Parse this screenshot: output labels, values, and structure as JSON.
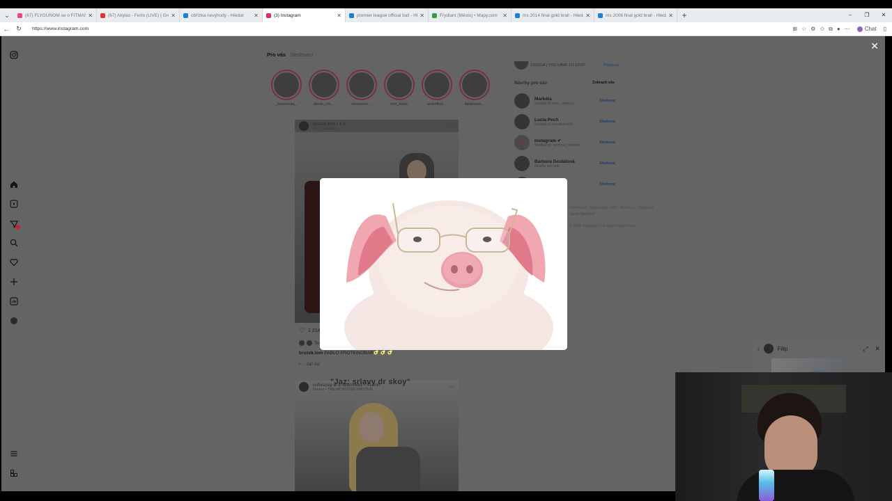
{
  "browser": {
    "tabs": [
      {
        "title": "(67) FLYGUNOM se o FITMANOVÁ",
        "active": false,
        "favicon_color": "#e64980"
      },
      {
        "title": "(67) Akylas - Ferto (LIVE) | Greece",
        "active": false,
        "favicon_color": "#e03131"
      },
      {
        "title": "obřízka nevýhody - Hledat",
        "active": false,
        "favicon_color": "#1c7ed6"
      },
      {
        "title": "(3) Instagram",
        "active": true,
        "favicon_color": "#d6336c"
      },
      {
        "title": "premier league official ball - Hle",
        "active": false,
        "favicon_color": "#1c7ed6"
      },
      {
        "title": "Frydlant (Město) • Mapy.com",
        "active": false,
        "favicon_color": "#2f9e44"
      },
      {
        "title": "ms 2014 final gold brall - Hledat",
        "active": false,
        "favicon_color": "#1c7ed6"
      },
      {
        "title": "ms 2006 final gold brall - Hledat",
        "active": false,
        "favicon_color": "#1c7ed6"
      }
    ],
    "url": "https://www.instagram.com",
    "chat_label": "Chat"
  },
  "feed": {
    "tab_for_you": "Pro vás",
    "tab_following": "Sledování",
    "stories": [
      {
        "name": "_bustomaa_"
      },
      {
        "name": "derek_cm..."
      },
      {
        "name": "meowens..."
      },
      {
        "name": "cmr_lvsds"
      },
      {
        "name": "arsenftvo..."
      },
      {
        "name": "italianava..."
      }
    ],
    "post1": {
      "author": "brozek.tom • 1 h",
      "location": "Pak Pracomy",
      "likes": "2 214",
      "liked_by": "To s",
      "caption_user": "brozek.tom",
      "caption_text": "PABLO PROTEINOBAR🥑 🥑 🥑",
      "more": "• ... dalí dál"
    },
    "post2": {
      "author": "cofixsosg ⊕ a sebdmkes • 41 min",
      "music": "Genex • THE MONSTER MASTER",
      "overlay_text": "\"Jaz: srlavy dr skoy\""
    }
  },
  "sidebar": {
    "me_name": "DOGGA",
    "me_sub": "DOGGA | YOU HAVE TO STOP",
    "me_switch": "Přepnout",
    "suggestions_title": "Návrhy pro vás",
    "see_all": "Zobrazit vše",
    "follow_label": "Sledovat",
    "suggestions": [
      {
        "name": "Markéta",
        "sub": "Sleduje tb.mak_vedanky"
      },
      {
        "name": "Lucia Pech",
        "sub": "Sleduje to noedjetmech"
      },
      {
        "name": "Instagram ✔",
        "sub": "Sleduje to: simcast_nobdek"
      },
      {
        "name": "Barbora Dostálová",
        "sub": "Návrhy pro vás"
      },
      {
        "name": "",
        "sub": ""
      }
    ],
    "footer_line1": "Informace · Nápověda · API · Ochrana · Sledovat",
    "footer_line2": "Jazyk Sledovat",
    "footer_line3": "© 2025 Instagram od společnosti Meta"
  },
  "chat": {
    "name": "Filip"
  },
  "icons": {
    "instagram": "instagram-icon",
    "home": "home-icon",
    "reels": "reels-icon",
    "messages": "messages-icon",
    "search": "search-icon",
    "notifications": "heart-icon",
    "create": "plus-icon",
    "dashboard": "dashboard-icon",
    "profile": "avatar",
    "menu": "hamburger-icon",
    "meta": "meta-icon"
  }
}
